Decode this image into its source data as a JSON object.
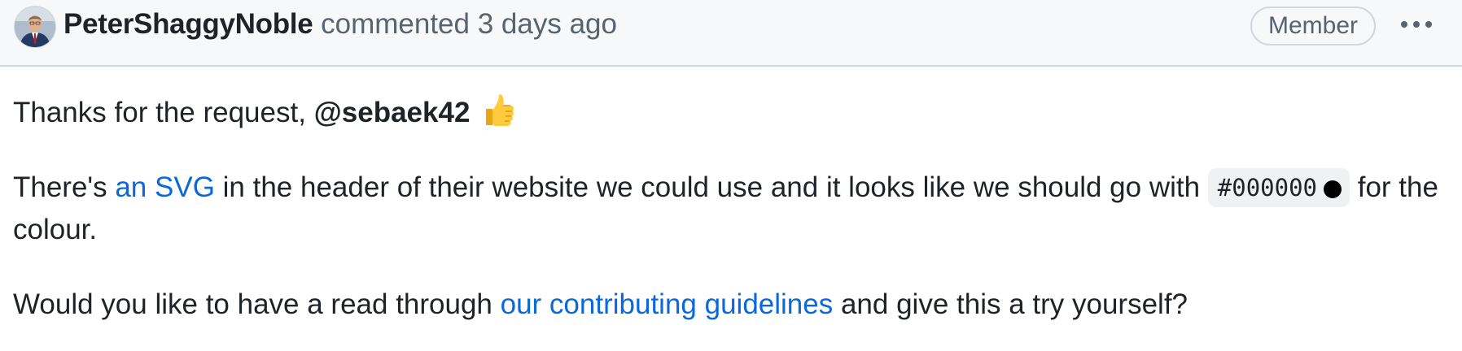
{
  "comment": {
    "author": "PeterShaggyNoble",
    "action": "commented",
    "time": "3 days ago",
    "role": "Member"
  },
  "body": {
    "p1": {
      "text": "Thanks for the request, ",
      "mention": "@sebaek42",
      "emoji": "thumbs-up"
    },
    "p2": {
      "before": "There's ",
      "link": "an SVG",
      "middle": " in the header of their website we could use and it looks like we should go with ",
      "code": "#000000",
      "after": " for the colour."
    },
    "p3": {
      "before": "Would you like to have a read through ",
      "link": "our contributing guidelines",
      "after": " and give this a try yourself?"
    }
  },
  "colors": {
    "link": "#0969da",
    "header_bg": "#f6f8fa",
    "swatch": "#000000"
  },
  "icons": [
    "avatar",
    "kebab-menu-icon",
    "thumbs-up-icon",
    "color-swatch-icon"
  ]
}
